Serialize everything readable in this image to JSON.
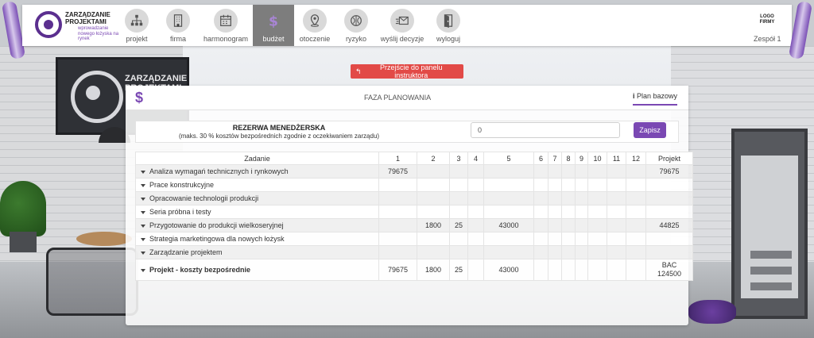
{
  "header": {
    "brand_title": "ZARZĄDZANIE PROJEKTAMI",
    "brand_subtitle": "wprowadzanie nowego łożyska na rynek",
    "logo_text": "LOGO FIRMY",
    "team": "Zespół 1",
    "nav": [
      {
        "label": "projekt",
        "icon": "org-chart-icon"
      },
      {
        "label": "firma",
        "icon": "building-icon"
      },
      {
        "label": "harmonogram",
        "icon": "calendar-icon"
      },
      {
        "label": "budżet",
        "icon": "dollar-icon",
        "active": true
      },
      {
        "label": "otoczenie",
        "icon": "location-pin-icon"
      },
      {
        "label": "ryzyko",
        "icon": "globe-risk-icon"
      },
      {
        "label": "wyślij decyzje",
        "icon": "send-mail-icon"
      },
      {
        "label": "wyloguj",
        "icon": "door-exit-icon"
      }
    ]
  },
  "instructor_button": "Przejście do panelu instruktora",
  "panel": {
    "phase": "FAZA PLANOWANIA",
    "plan_tab": "Plan bazowy",
    "reserve": {
      "title": "REZERWA MENEDŻERSKA",
      "subtitle": "(maks. 30 % kosztów bezpośrednich zgodnie z oczekiwaniem zarządu)",
      "value": "0",
      "save_label": "Zapisz"
    },
    "table": {
      "headers": [
        "Zadanie",
        "1",
        "2",
        "3",
        "4",
        "5",
        "6",
        "7",
        "8",
        "9",
        "10",
        "11",
        "12",
        "Projekt"
      ],
      "rows": [
        [
          "Analiza wymagań technicznych i rynkowych",
          "79675",
          "",
          "",
          "",
          "",
          "",
          "",
          "",
          "",
          "",
          "",
          "",
          "79675"
        ],
        [
          "Prace konstrukcyjne",
          "",
          "",
          "",
          "",
          "",
          "",
          "",
          "",
          "",
          "",
          "",
          "",
          ""
        ],
        [
          "Opracowanie technologii produkcji",
          "",
          "",
          "",
          "",
          "",
          "",
          "",
          "",
          "",
          "",
          "",
          "",
          ""
        ],
        [
          "Seria próbna i testy",
          "",
          "",
          "",
          "",
          "",
          "",
          "",
          "",
          "",
          "",
          "",
          "",
          ""
        ],
        [
          "Przygotowanie do produkcji wielkoseryjnej",
          "",
          "1800",
          "25",
          "",
          "43000",
          "",
          "",
          "",
          "",
          "",
          "",
          "",
          "44825"
        ],
        [
          "Strategia marketingowa dla nowych łożysk",
          "",
          "",
          "",
          "",
          "",
          "",
          "",
          "",
          "",
          "",
          "",
          "",
          ""
        ],
        [
          "Zarządzanie projektem",
          "",
          "",
          "",
          "",
          "",
          "",
          "",
          "",
          "",
          "",
          "",
          "",
          ""
        ]
      ],
      "total": {
        "label": "Projekt - koszty bezpośrednie",
        "values": [
          "79675",
          "1800",
          "25",
          "",
          "43000",
          "",
          "",
          "",
          "",
          "",
          "",
          ""
        ],
        "bac_label": "BAC",
        "bac_value": "124500"
      }
    }
  },
  "colors": {
    "accent": "#7a48b3",
    "instructor_button": "#e24a47",
    "active_nav": "#7d7d7d"
  }
}
